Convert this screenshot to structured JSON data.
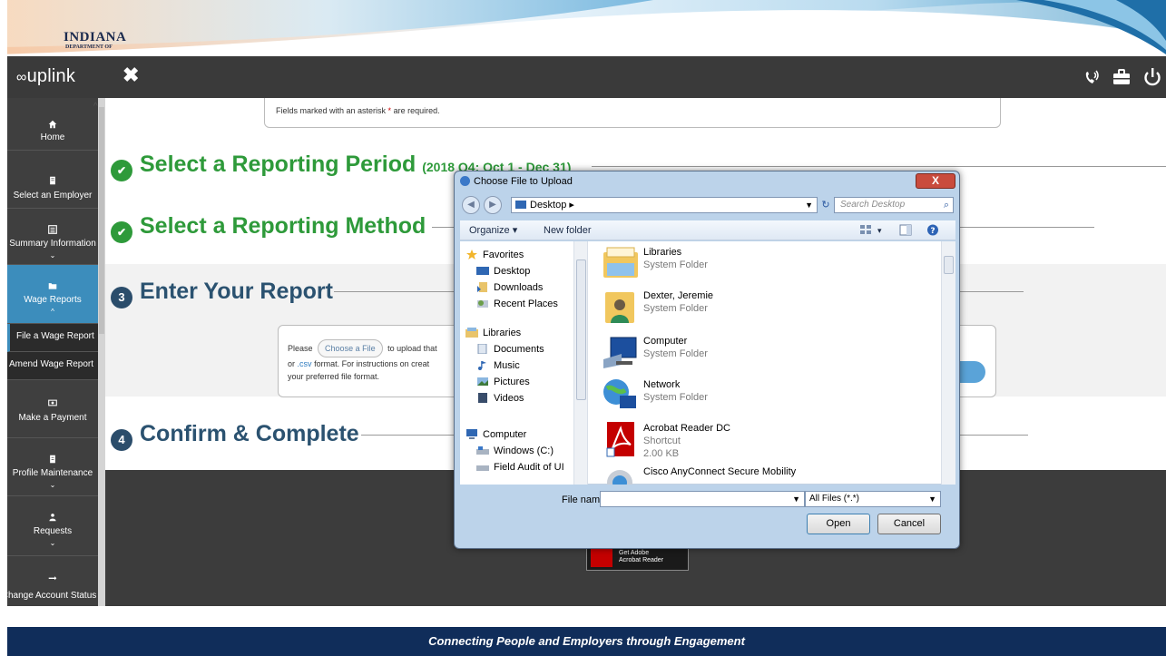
{
  "logo": {
    "title": "INDIANA",
    "subtitle": "DEPARTMENT OF"
  },
  "appbar": {
    "brand": "uplink",
    "brand_mark": "∞",
    "close_glyph": "✖"
  },
  "sidebar": {
    "home": "Home",
    "select_employer": "Select an Employer",
    "summary": "Summary Information",
    "wage_reports": "Wage Reports",
    "file_wage": "File a Wage Report",
    "amend_wage": "Amend Wage Report",
    "make_payment": "Make a Payment",
    "profile": "Profile Maintenance",
    "requests": "Requests",
    "change_status": "Change Account Status",
    "chevron_down": "⌄",
    "chevron_up": "^"
  },
  "main": {
    "required_pre": "Fields marked with an asterisk ",
    "required_ast": "*",
    "required_post": " are required.",
    "step1": "Select a Reporting Period",
    "step1_period": "(2018 Q4: Oct 1 - Dec 31)",
    "step2": "Select a Reporting Method",
    "step3_num": "3",
    "step3": "Enter Your Report",
    "step4_num": "4",
    "step4": "Confirm & Complete",
    "upload_please": "Please",
    "upload_choose": "Choose a File",
    "upload_after": "to upload that",
    "upload_line2a": "or",
    "upload_csv": ".csv",
    "upload_line2b": "format. For instructions on creat",
    "upload_line3": "your preferred file format.",
    "adobe_line1": "Get Adobe",
    "adobe_line2": "Acrobat Reader"
  },
  "dialog": {
    "title": "Choose File to Upload",
    "close": "X",
    "back": "◀",
    "forward": "▶",
    "address": "Desktop ▸",
    "search_placeholder": "Search Desktop",
    "organize": "Organize ▾",
    "new_folder": "New folder",
    "tree": {
      "favorites": "Favorites",
      "desktop": "Desktop",
      "downloads": "Downloads",
      "recent": "Recent Places",
      "libraries": "Libraries",
      "documents": "Documents",
      "music": "Music",
      "pictures": "Pictures",
      "videos": "Videos",
      "computer": "Computer",
      "windows": "Windows (C:)",
      "field_audit": "Field Audit of UI"
    },
    "files": [
      {
        "name": "Libraries",
        "type": "System Folder",
        "size": ""
      },
      {
        "name": "Dexter, Jeremie",
        "type": "System Folder",
        "size": ""
      },
      {
        "name": "Computer",
        "type": "System Folder",
        "size": ""
      },
      {
        "name": "Network",
        "type": "System Folder",
        "size": ""
      },
      {
        "name": "Acrobat Reader DC",
        "type": "Shortcut",
        "size": "2.00 KB"
      },
      {
        "name": "Cisco AnyConnect Secure Mobility",
        "type": "",
        "size": ""
      }
    ],
    "file_name_label": "File name:",
    "file_name_value": "",
    "file_type": "All Files (*.*)",
    "open": "Open",
    "cancel": "Cancel"
  },
  "footer": {
    "tagline": "Connecting People and Employers through Engagement"
  },
  "colors": {
    "green": "#2e9a3a",
    "navy": "#2b5270",
    "active_nav": "#3c8dbc",
    "banner": "#102d5a"
  }
}
